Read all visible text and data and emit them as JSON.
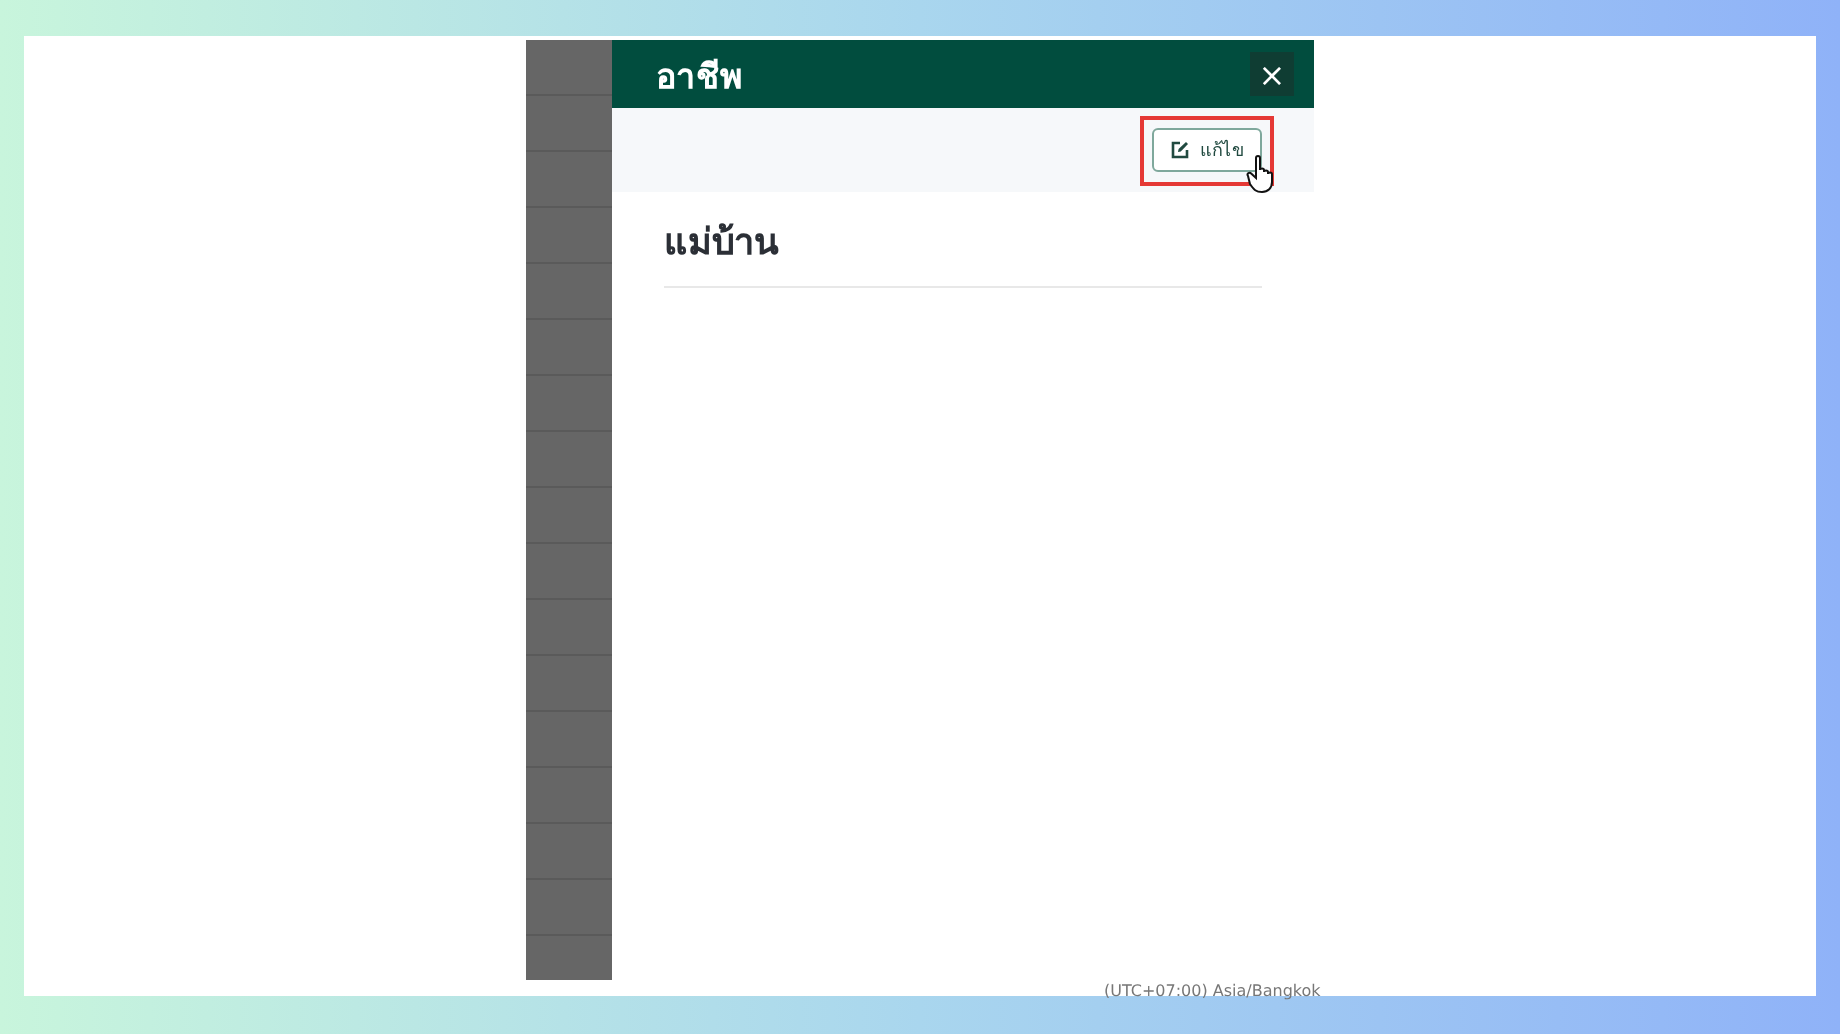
{
  "dialog": {
    "title": "อาชีพ",
    "close_label": "×",
    "edit_button": {
      "label": "แก้ไข",
      "highlighted": true
    },
    "value": "แม่บ้าน"
  },
  "footer": {
    "timezone": "(UTC+07:00) Asia/Bangkok"
  }
}
